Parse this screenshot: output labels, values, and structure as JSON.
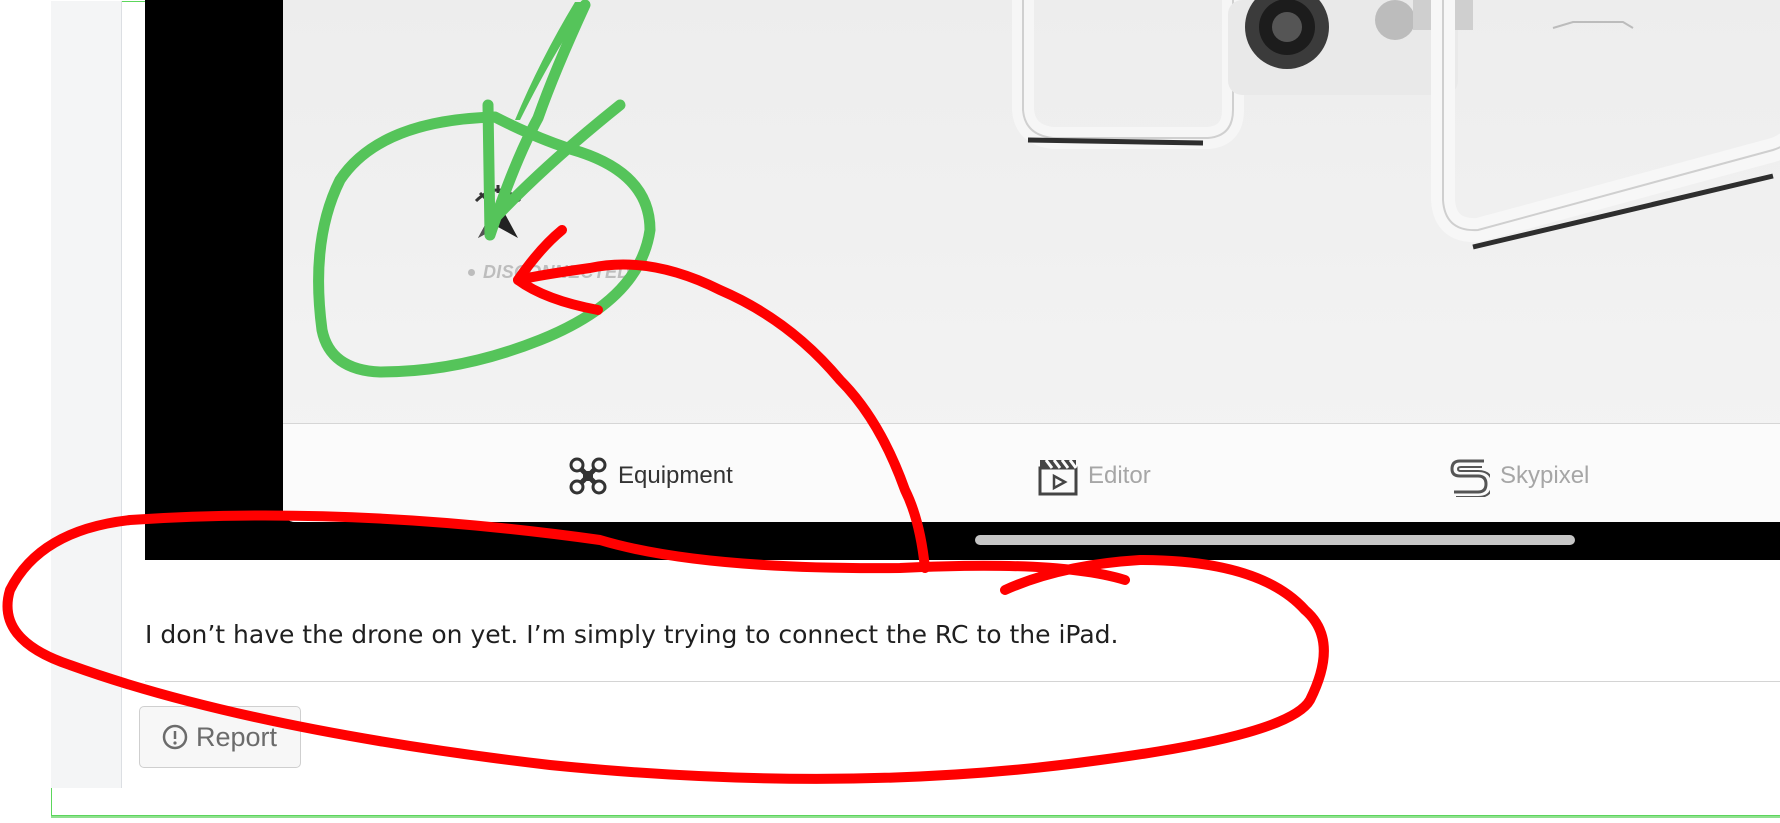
{
  "app": {
    "tabs": [
      {
        "label": "Equipment",
        "icon": "drone-icon",
        "active": true
      },
      {
        "label": "Editor",
        "icon": "clapperboard-icon",
        "active": false
      },
      {
        "label": "Skypixel",
        "icon": "skypixel-logo-icon",
        "active": false
      }
    ],
    "status": {
      "label": "DISCONNECTED",
      "icon": "gps-arrow-icon"
    }
  },
  "post": {
    "text": "I don’t have the drone on yet. I’m simply trying to connect the RC to the iPad."
  },
  "actions": {
    "report_label": "Report",
    "report_icon": "alert-circle-icon"
  },
  "colors": {
    "annotation_red": "#ff0000",
    "annotation_green": "#55c45a",
    "active_tab": "#333333",
    "inactive_tab": "#a6a6a6"
  }
}
